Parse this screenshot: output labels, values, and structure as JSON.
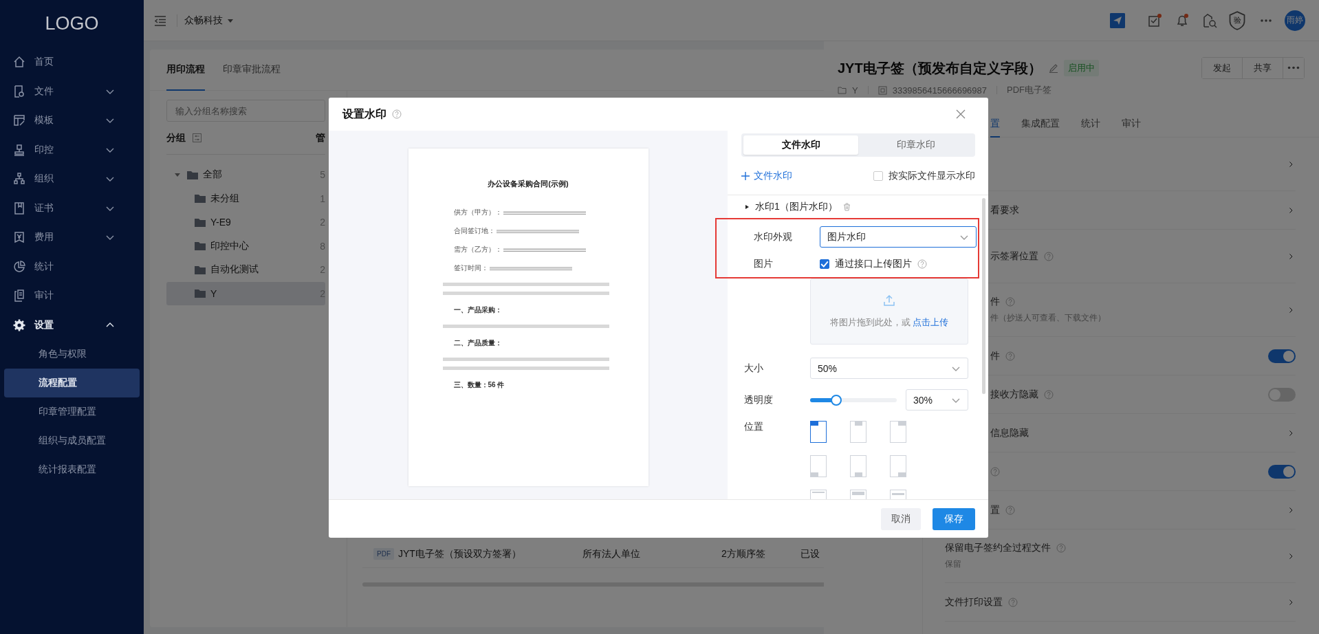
{
  "sidebar": {
    "logo": "LOGO",
    "items": [
      {
        "label": "首页"
      },
      {
        "label": "文件",
        "expanded": false
      },
      {
        "label": "模板",
        "expanded": false
      },
      {
        "label": "印控",
        "expanded": false
      },
      {
        "label": "组织",
        "expanded": false
      },
      {
        "label": "证书",
        "expanded": false
      },
      {
        "label": "费用",
        "expanded": false
      },
      {
        "label": "统计"
      },
      {
        "label": "审计"
      },
      {
        "label": "设置",
        "expanded": true,
        "children": [
          {
            "label": "角色与权限",
            "selected": false
          },
          {
            "label": "流程配置",
            "selected": true
          },
          {
            "label": "印章管理配置",
            "selected": false
          },
          {
            "label": "组织与成员配置",
            "selected": false
          },
          {
            "label": "统计报表配置",
            "selected": false
          }
        ]
      }
    ]
  },
  "topbar": {
    "org": "众畅科技",
    "verify": "验",
    "avatar": "雨婷"
  },
  "card": {
    "tabs": [
      {
        "label": "用印流程",
        "selected": true
      },
      {
        "label": "印章审批流程",
        "selected": false
      }
    ],
    "search": {
      "placeholder": "输入分组名称搜索"
    },
    "group_header": "分组",
    "column_2": "管",
    "groups": [
      {
        "label": "全部",
        "count": "5",
        "expanded": true,
        "selected": false,
        "children": [
          {
            "label": "未分组",
            "count": "1",
            "selected": false
          },
          {
            "label": "Y-E9",
            "count": "2",
            "selected": false
          },
          {
            "label": "印控中心",
            "count": "8",
            "selected": false
          },
          {
            "label": "自动化测试",
            "count": "2",
            "selected": false
          },
          {
            "label": "Y",
            "count": "2",
            "selected": true
          }
        ]
      }
    ],
    "table": {
      "rows": [
        {
          "badge": "PDF",
          "name": "JYT电子签（预设双方签署）",
          "column_2": "所有法人单位",
          "column_3": "2方顺序签",
          "column_4": "已设"
        }
      ]
    }
  },
  "drawer": {
    "title": "JYT电子签（预发布自定义字段）",
    "status": "启用中",
    "buttons": [
      "发起",
      "共享"
    ],
    "meta": {
      "folder": "Y",
      "id": "3339856415666696987",
      "type": "PDF电子签"
    },
    "tabs": [
      {
        "label": "置",
        "selected": true
      },
      {
        "label": "集成配置",
        "selected": false
      },
      {
        "label": "统计",
        "selected": false
      },
      {
        "label": "审计",
        "selected": false
      }
    ],
    "settings": [
      {
        "kind": "link",
        "has_hidden_line": true
      },
      {
        "kind": "link",
        "title": "看要求",
        "covered": true
      },
      {
        "kind": "link",
        "title": "示签署位置",
        "help": true,
        "covered": true,
        "has_hidden_line": true
      },
      {
        "kind": "link",
        "title": "件",
        "help": true,
        "desc": "件（抄送人可查看、下载文件）",
        "covered": true
      },
      {
        "kind": "toggle",
        "title": "件",
        "help": true,
        "on": true,
        "covered": true
      },
      {
        "kind": "toggle",
        "title": "接收方隐藏",
        "help": true,
        "on": false,
        "covered": true
      },
      {
        "kind": "link",
        "title": "信息隐藏",
        "covered": true
      },
      {
        "kind": "toggle",
        "help": true,
        "on": true,
        "covered": true
      },
      {
        "kind": "link",
        "title": "置",
        "help": true,
        "covered": true
      },
      {
        "kind": "link",
        "title": "保留电子签约全过程文件",
        "help": true,
        "desc": "保留",
        "covered": false
      },
      {
        "kind": "link",
        "title": "文件打印设置",
        "help": true,
        "covered": false
      }
    ]
  },
  "modal": {
    "title": "设置水印",
    "document": {
      "title": "办公设备采购合同(示例)",
      "lines": [
        {
          "kind": "field",
          "label": "供方（甲方）："
        },
        {
          "kind": "field",
          "label": "合同签订地："
        },
        {
          "kind": "field",
          "label": "需方（乙方）："
        },
        {
          "kind": "field",
          "label": "签订时间："
        },
        {
          "kind": "paragraph"
        },
        {
          "kind": "heading",
          "label": "一、产品采购："
        },
        {
          "kind": "line"
        },
        {
          "kind": "heading",
          "label": "二、产品质量："
        },
        {
          "kind": "paragraph"
        },
        {
          "kind": "heading",
          "label": "三、数量：56 件"
        }
      ]
    },
    "tabs": [
      {
        "label": "文件水印",
        "selected": true
      },
      {
        "label": "印章水印",
        "selected": false
      }
    ],
    "add_label": "文件水印",
    "actual_size": {
      "label": "按实际文件显示水印",
      "checked": false
    },
    "watermark": {
      "title": "水印1（图片水印）",
      "expanded": true
    },
    "form": [
      {
        "kind": "select",
        "label": "水印外观",
        "value": "图片水印",
        "focused": true,
        "highlighted": true
      },
      {
        "kind": "checkbox",
        "label": "图片",
        "text": "通过接口上传图片",
        "checked": true,
        "highlighted": true
      },
      {
        "kind": "upload",
        "hint": "将图片拖到此处，或",
        "link": "点击上传",
        "highlighted": false
      },
      {
        "kind": "select",
        "label": "大小",
        "value": "50%",
        "focused": false,
        "highlighted": false
      },
      {
        "kind": "slider",
        "label": "透明度",
        "level": 0.3,
        "value": "30%",
        "highlighted": false
      },
      {
        "kind": "positions",
        "label": "位置",
        "highlighted": false,
        "options": [
          {
            "kind": "topleft",
            "selected": true
          },
          {
            "kind": "topcenter",
            "selected": false
          },
          {
            "kind": "topright",
            "selected": false
          },
          {
            "kind": "bottomleft",
            "selected": false
          },
          {
            "kind": "bottomcenter",
            "selected": false
          },
          {
            "kind": "bottomright",
            "selected": false
          },
          {
            "kind": "tiled",
            "selected": false
          },
          {
            "kind": "grid",
            "selected": false
          },
          {
            "kind": "band",
            "selected": false
          }
        ]
      }
    ],
    "buttons": [
      {
        "label": "取消",
        "kind": "secondary"
      },
      {
        "label": "保存",
        "kind": "primary"
      }
    ]
  }
}
